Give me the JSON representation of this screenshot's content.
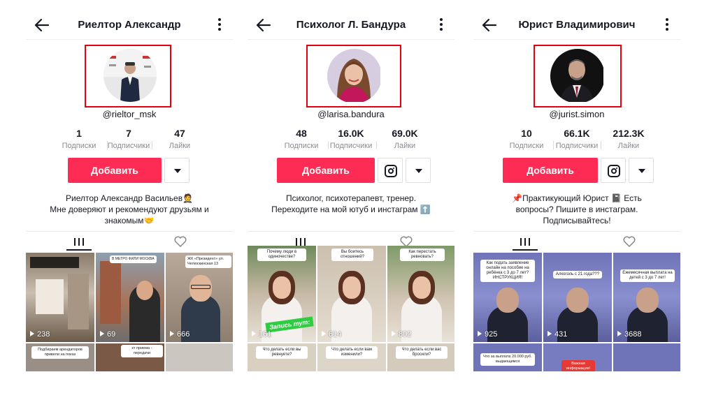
{
  "profiles": [
    {
      "title": "Риелтор Александр",
      "handle": "@rieltor_msk",
      "stats": [
        {
          "value": "1",
          "label": "Подписки"
        },
        {
          "value": "7",
          "label": "Подписчики"
        },
        {
          "value": "47",
          "label": "Лайки"
        }
      ],
      "follow_label": "Добавить",
      "has_instagram": false,
      "bio": [
        "Риелтор Александр Васильев🤵",
        "Мне доверяют и рекомендуют друзьям и",
        "знакомым🤝"
      ],
      "videos": [
        {
          "views": "238",
          "caption": ""
        },
        {
          "views": "69",
          "caption": "В МЕТРО ФИЛИ МОСКВА"
        },
        {
          "views": "666",
          "caption": "ЖК «Президент» ул. Челюскинская 13"
        }
      ],
      "bottom_captions": [
        "Подбираем арендаторов привели на показ",
        "",
        "кт приема - передачи"
      ]
    },
    {
      "title": "Психолог Л. Бандура",
      "handle": "@larisa.bandura",
      "stats": [
        {
          "value": "48",
          "label": "Подписки"
        },
        {
          "value": "16.0K",
          "label": "Подписчики"
        },
        {
          "value": "69.0K",
          "label": "Лайки"
        }
      ],
      "follow_label": "Добавить",
      "has_instagram": true,
      "bio": [
        "Психолог, психотерапевт, тренер.",
        "Переходите на мой ютуб и инстаграм ⬆️"
      ],
      "videos": [
        {
          "views": "161",
          "caption": "Почему люди в одиночестве?",
          "sticker": "Запись тут:"
        },
        {
          "views": "614",
          "caption": "Вы боитесь отношений?"
        },
        {
          "views": "802",
          "caption": "Как перестать ревновать?"
        }
      ],
      "bottom_captions": [
        "Что делать если вы ревнуете?",
        "Что делать если вам изменили?",
        "Что делать если вас бросили?"
      ]
    },
    {
      "title": "Юрист Владимирович",
      "handle": "@jurist.simon",
      "stats": [
        {
          "value": "10",
          "label": "Подписки"
        },
        {
          "value": "66.1K",
          "label": "Подписчики"
        },
        {
          "value": "212.3K",
          "label": "Лайки"
        }
      ],
      "follow_label": "Добавить",
      "has_instagram": true,
      "bio": [
        "📌Практикующий Юрист 📓 Есть",
        "вопросы? Пишите в инстаграм.",
        "Подписывайтесь!"
      ],
      "videos": [
        {
          "views": "925",
          "caption": "Как подать заявление онлайн на пособие на ребёнка с 3 до 7 лет? ИНСТРУКЦИЯ!"
        },
        {
          "views": "431",
          "caption": "Алкоголь с 21 года???"
        },
        {
          "views": "3688",
          "caption": "Ежемесячная выплата на детей с 3 до 7 лет!"
        }
      ],
      "bottom_captions": [
        "Что за выплата 20.000 руб. выдающимся",
        "Важная информация!",
        ""
      ]
    }
  ],
  "colors": {
    "accent": "#fe2c55",
    "highlight_box": "#e3000f",
    "text": "#161823",
    "muted": "#8a8b91"
  }
}
